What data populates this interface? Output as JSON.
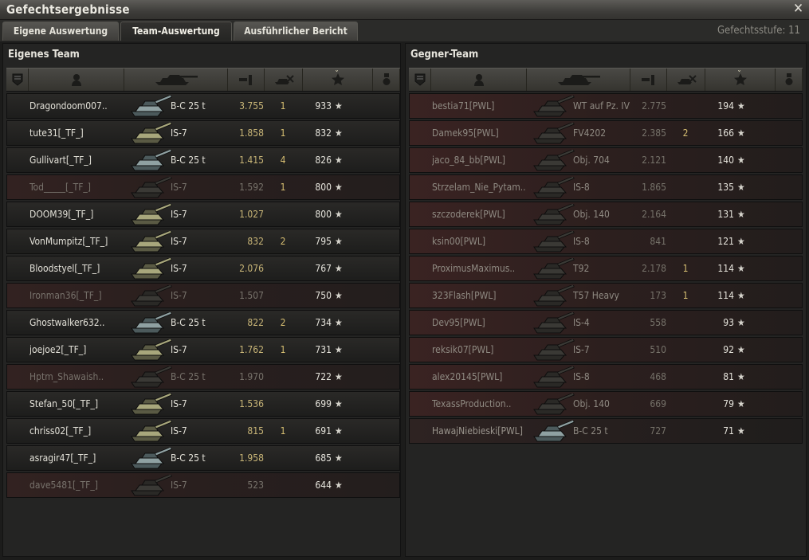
{
  "window": {
    "title": "Gefechtsergebnisse"
  },
  "tabs": [
    {
      "label": "Eigene Auswertung"
    },
    {
      "label": "Team-Auswertung"
    },
    {
      "label": "Ausführlicher Bericht"
    }
  ],
  "battle_level": "Gefechtsstufe: 11",
  "own_team": {
    "title": "Eigenes Team",
    "players": [
      {
        "name": "Dragondoom007..",
        "tank": "B-C 25 t",
        "damage": "3.755",
        "kills": "1",
        "xp": "933",
        "dead": false,
        "tank_class": "medium"
      },
      {
        "name": "tute31[_TF_]",
        "tank": "IS-7",
        "damage": "1.858",
        "kills": "1",
        "xp": "832",
        "dead": false,
        "tank_class": "heavy"
      },
      {
        "name": "Gullivart[_TF_]",
        "tank": "B-C 25 t",
        "damage": "1.415",
        "kills": "4",
        "xp": "826",
        "dead": false,
        "tank_class": "medium"
      },
      {
        "name": "Tod_____[_TF_]",
        "tank": "IS-7",
        "damage": "1.592",
        "kills": "1",
        "xp": "800",
        "dead": true,
        "tank_class": "heavy"
      },
      {
        "name": "DOOM39[_TF_]",
        "tank": "IS-7",
        "damage": "1.027",
        "kills": "",
        "xp": "800",
        "dead": false,
        "tank_class": "heavy"
      },
      {
        "name": "VonMumpitz[_TF_]",
        "tank": "IS-7",
        "damage": "832",
        "kills": "2",
        "xp": "795",
        "dead": false,
        "tank_class": "heavy"
      },
      {
        "name": "Bloodstyel[_TF_]",
        "tank": "IS-7",
        "damage": "2.076",
        "kills": "",
        "xp": "767",
        "dead": false,
        "tank_class": "heavy"
      },
      {
        "name": "Ironman36[_TF_]",
        "tank": "IS-7",
        "damage": "1.507",
        "kills": "",
        "xp": "750",
        "dead": true,
        "tank_class": "heavy"
      },
      {
        "name": "Ghostwalker632..",
        "tank": "B-C 25 t",
        "damage": "822",
        "kills": "2",
        "xp": "734",
        "dead": false,
        "tank_class": "medium"
      },
      {
        "name": "joejoe2[_TF_]",
        "tank": "IS-7",
        "damage": "1.762",
        "kills": "1",
        "xp": "731",
        "dead": false,
        "tank_class": "heavy"
      },
      {
        "name": "Hptm_Shawaish..",
        "tank": "B-C 25 t",
        "damage": "1.970",
        "kills": "",
        "xp": "722",
        "dead": true,
        "tank_class": "medium"
      },
      {
        "name": "Stefan_50[_TF_]",
        "tank": "IS-7",
        "damage": "1.536",
        "kills": "",
        "xp": "699",
        "dead": false,
        "tank_class": "heavy"
      },
      {
        "name": "chriss02[_TF_]",
        "tank": "IS-7",
        "damage": "815",
        "kills": "1",
        "xp": "691",
        "dead": false,
        "tank_class": "heavy"
      },
      {
        "name": "asragir47[_TF_]",
        "tank": "B-C 25 t",
        "damage": "1.958",
        "kills": "",
        "xp": "685",
        "dead": false,
        "tank_class": "medium"
      },
      {
        "name": "dave5481[_TF_]",
        "tank": "IS-7",
        "damage": "523",
        "kills": "",
        "xp": "644",
        "dead": true,
        "tank_class": "heavy"
      }
    ]
  },
  "enemy_team": {
    "title": "Gegner-Team",
    "players": [
      {
        "name": "bestia71[PWL]",
        "tank": "WT auf Pz. IV",
        "damage": "2.775",
        "kills": "",
        "xp": "194",
        "dead": true,
        "tank_class": "td"
      },
      {
        "name": "Damek95[PWL]",
        "tank": "FV4202",
        "damage": "2.385",
        "kills": "2",
        "xp": "166",
        "dead": true,
        "tank_class": "medium"
      },
      {
        "name": "jaco_84_bb[PWL]",
        "tank": "Obj. 704",
        "damage": "2.121",
        "kills": "",
        "xp": "140",
        "dead": true,
        "tank_class": "td"
      },
      {
        "name": "Strzelam_Nie_Pytam..",
        "tank": "IS-8",
        "damage": "1.865",
        "kills": "",
        "xp": "135",
        "dead": true,
        "tank_class": "heavy"
      },
      {
        "name": "szczoderek[PWL]",
        "tank": "Obj. 140",
        "damage": "2.164",
        "kills": "",
        "xp": "131",
        "dead": true,
        "tank_class": "medium"
      },
      {
        "name": "ksin00[PWL]",
        "tank": "IS-8",
        "damage": "841",
        "kills": "",
        "xp": "121",
        "dead": true,
        "tank_class": "heavy"
      },
      {
        "name": "ProximusMaximus..",
        "tank": "T92",
        "damage": "2.178",
        "kills": "1",
        "xp": "114",
        "dead": true,
        "tank_class": "spg"
      },
      {
        "name": "323Flash[PWL]",
        "tank": "T57 Heavy",
        "damage": "173",
        "kills": "1",
        "xp": "114",
        "dead": true,
        "tank_class": "heavy"
      },
      {
        "name": "Dev95[PWL]",
        "tank": "IS-4",
        "damage": "558",
        "kills": "",
        "xp": "93",
        "dead": true,
        "tank_class": "heavy"
      },
      {
        "name": "reksik07[PWL]",
        "tank": "IS-7",
        "damage": "510",
        "kills": "",
        "xp": "92",
        "dead": true,
        "tank_class": "heavy"
      },
      {
        "name": "alex20145[PWL]",
        "tank": "IS-8",
        "damage": "468",
        "kills": "",
        "xp": "81",
        "dead": true,
        "tank_class": "heavy"
      },
      {
        "name": "TexassProduction..",
        "tank": "Obj. 140",
        "damage": "669",
        "kills": "",
        "xp": "79",
        "dead": true,
        "tank_class": "medium"
      },
      {
        "name": "HawajNiebieski[PWL]",
        "tank": "B-C 25 t",
        "damage": "727",
        "kills": "",
        "xp": "71",
        "dead": false,
        "tank_class": "medium"
      }
    ]
  },
  "columns": [
    {
      "icon": "squad-icon"
    },
    {
      "icon": "player-icon"
    },
    {
      "icon": "tank-icon"
    },
    {
      "icon": "damage-icon"
    },
    {
      "icon": "kills-icon"
    },
    {
      "icon": "xp-star-icon",
      "sorted": true
    },
    {
      "icon": "medal-icon"
    }
  ],
  "colors": {
    "accent": "#d7bf72",
    "damage_own": "#c8b577",
    "text_light": "#e3e1d8",
    "dead_text": "#77726b"
  }
}
